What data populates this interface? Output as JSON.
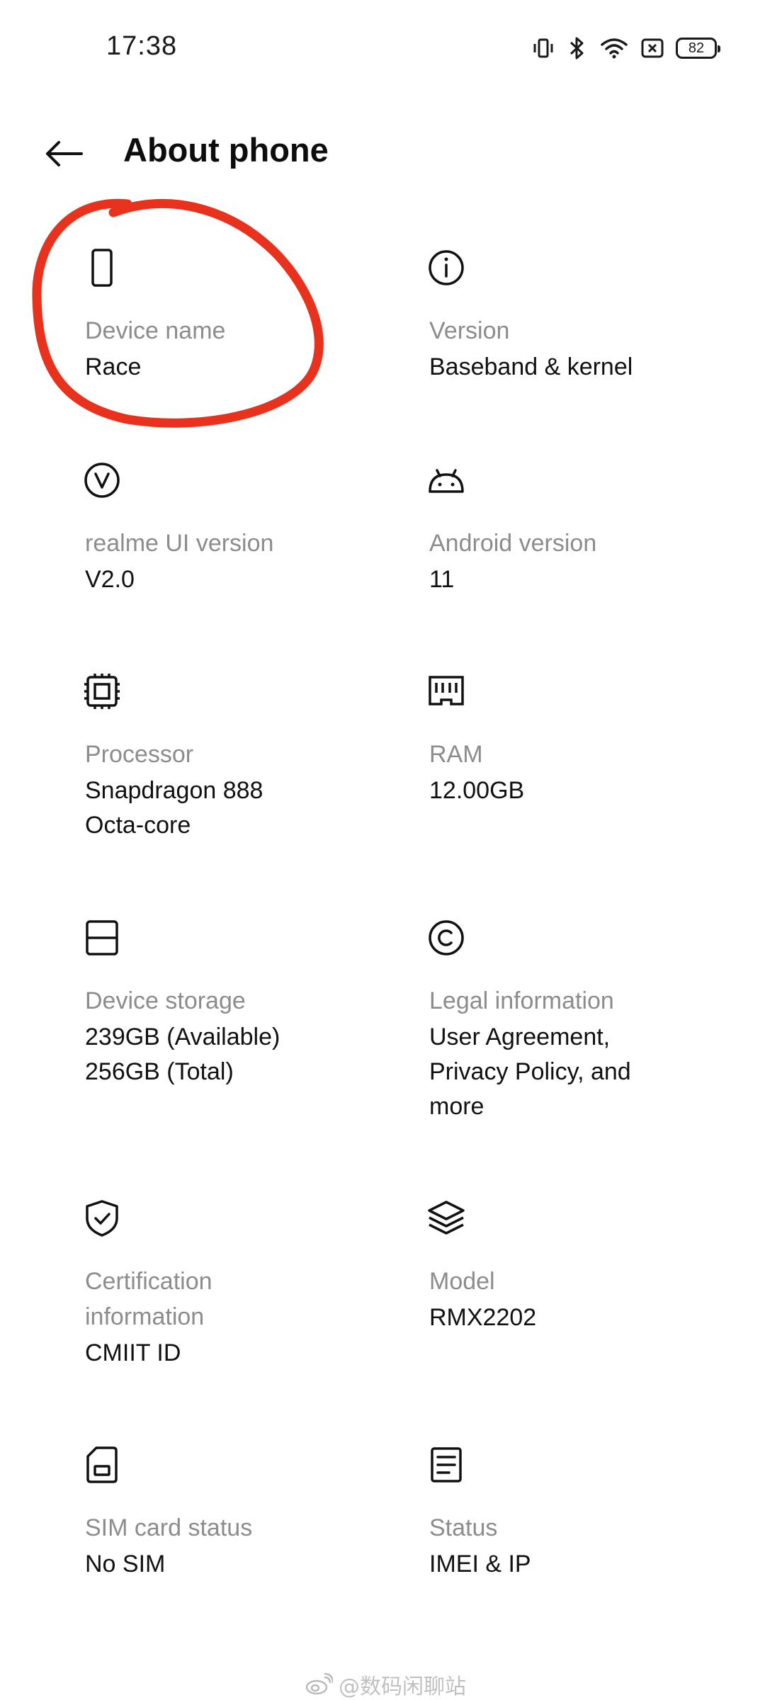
{
  "status_bar": {
    "time": "17:38",
    "battery_level": "82",
    "icons": [
      "vibrate-icon",
      "bluetooth-icon",
      "wifi-icon",
      "no-sim-icon",
      "battery-icon"
    ]
  },
  "header": {
    "back_icon": "back-arrow-icon",
    "title": "About phone"
  },
  "items": [
    {
      "icon": "phone-icon",
      "label": "Device name",
      "value": "Race"
    },
    {
      "icon": "info-icon",
      "label": "Version",
      "value": "Baseband & kernel"
    },
    {
      "icon": "realme-v-icon",
      "label": "realme UI version",
      "value": "V2.0"
    },
    {
      "icon": "android-icon",
      "label": "Android version",
      "value": "11"
    },
    {
      "icon": "chip-icon",
      "label": "Processor",
      "value": "Snapdragon 888\nOcta-core"
    },
    {
      "icon": "ram-icon",
      "label": "RAM",
      "value": "12.00GB"
    },
    {
      "icon": "storage-icon",
      "label": "Device storage",
      "value": "239GB (Available)\n256GB (Total)"
    },
    {
      "icon": "copyright-icon",
      "label": "Legal information",
      "value": "User Agreement,\nPrivacy Policy, and\nmore"
    },
    {
      "icon": "shield-check-icon",
      "label": "Certification\ninformation",
      "value": "CMIIT ID"
    },
    {
      "icon": "layers-icon",
      "label": "Model",
      "value": "RMX2202"
    },
    {
      "icon": "sim-card-icon",
      "label": "SIM card status",
      "value": "No SIM"
    },
    {
      "icon": "document-icon",
      "label": "Status",
      "value": "IMEI & IP"
    }
  ],
  "annotation": {
    "color": "#e8321e"
  },
  "watermark": {
    "text": "@数码闲聊站",
    "icon": "weibo-icon"
  }
}
